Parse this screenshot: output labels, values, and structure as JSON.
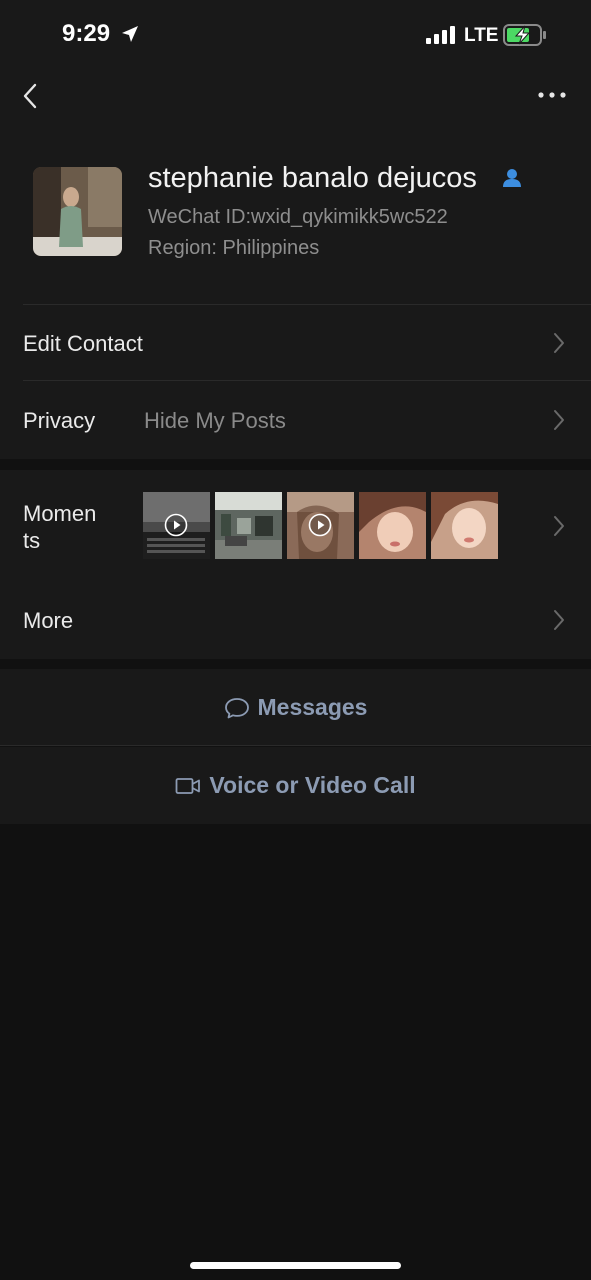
{
  "status_bar": {
    "time": "9:29",
    "network": "LTE",
    "icons": [
      "location-arrow-icon",
      "signal-icon",
      "battery-charging-icon"
    ]
  },
  "nav": {
    "back_icon": "chevron-left-icon",
    "more_icon": "ellipsis-icon"
  },
  "profile": {
    "name": "stephanie banalo dejucos",
    "wechat_id": "WeChat ID:wxid_qykimikk5wc522",
    "region": "Region: Philippines",
    "badge_icon": "person-icon"
  },
  "rows": {
    "edit_contact": {
      "label": "Edit Contact"
    },
    "privacy": {
      "label": "Privacy",
      "value": "Hide My Posts"
    },
    "moments": {
      "label_line1": "Momen",
      "label_line2": "ts",
      "thumbnails": [
        {
          "kind": "video",
          "description": "keyboard"
        },
        {
          "kind": "photo",
          "description": "office"
        },
        {
          "kind": "video",
          "description": "portrait"
        },
        {
          "kind": "photo",
          "description": "portrait"
        },
        {
          "kind": "photo",
          "description": "portrait"
        }
      ]
    },
    "more": {
      "label": "More"
    }
  },
  "actions": {
    "messages": {
      "label": "Messages",
      "icon": "chat-bubble-icon"
    },
    "call": {
      "label": "Voice or Video Call",
      "icon": "video-camera-icon"
    }
  },
  "colors": {
    "background": "#111111",
    "surface": "#191919",
    "action_text": "#8c9bb3",
    "badge_blue": "#3d8ee0"
  }
}
